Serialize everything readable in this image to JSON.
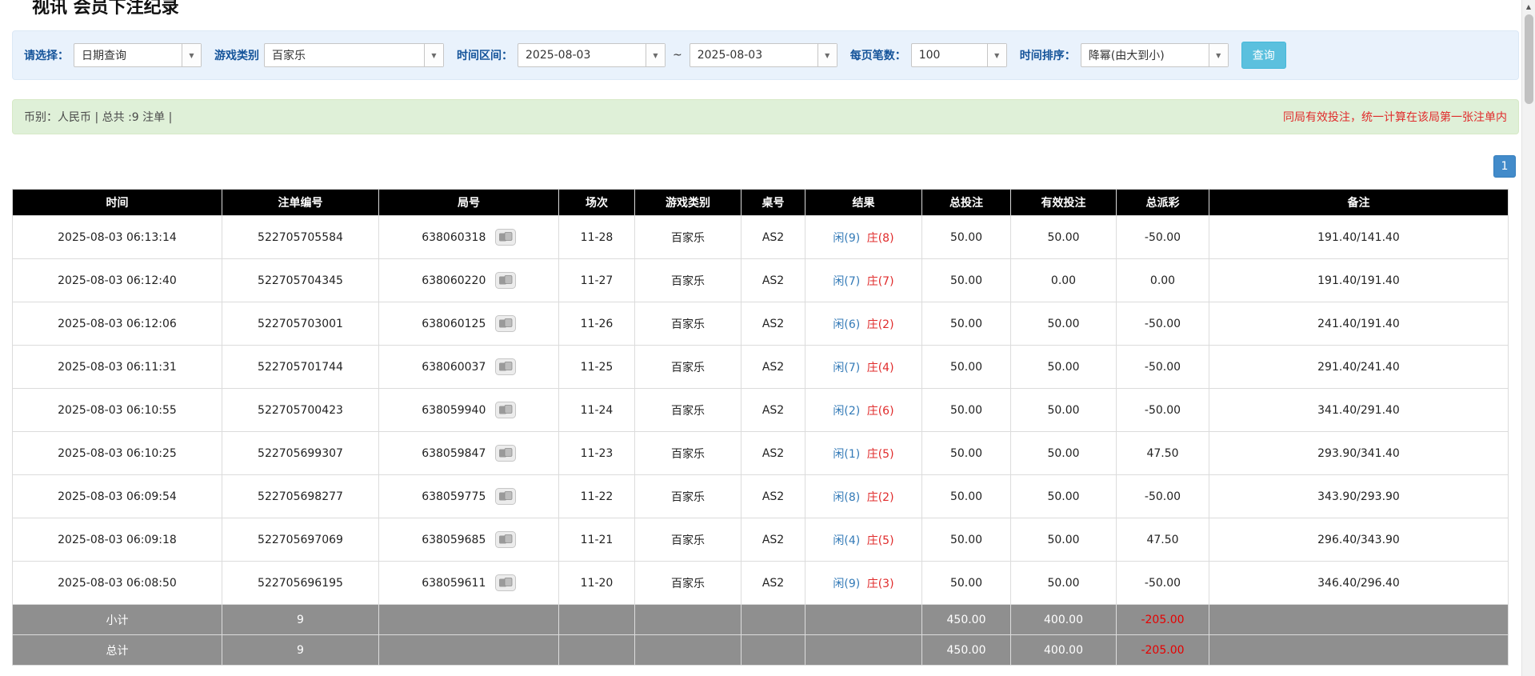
{
  "page": {
    "title": "视讯 会员下注纪录"
  },
  "icons": {
    "dropdown_caret": "▼",
    "scroll_up_arrow": "▲",
    "replay": "replay-icon"
  },
  "colors": {
    "link_blue": "#337ab7",
    "red": "#e02b2b",
    "header_bg": "#000000",
    "footer_bg": "#8f8f8f",
    "filter_bg": "#e9f2fc",
    "summary_bg": "#dff0d8",
    "query_button_bg": "#5bc0de",
    "pagination_bg": "#428bca"
  },
  "filters": {
    "select_label": "请选择：",
    "select_value": "日期查询",
    "game_type_label": "游戏类别",
    "game_type_value": "百家乐",
    "date_range_label": "时间区间：",
    "date_from": "2025-08-03",
    "date_to": "2025-08-03",
    "range_separator": "~",
    "page_size_label": "每页笔数：",
    "page_size_value": "100",
    "sort_label": "时间排序：",
    "sort_value": "降幂(由大到小)",
    "search_button": "查询"
  },
  "summary": {
    "left": "币别：人民币 | 总共 :9 注单 |",
    "right": "同局有效投注，统一计算在该局第一张注单内"
  },
  "pagination": {
    "current": "1"
  },
  "table": {
    "headers": [
      "时间",
      "注单编号",
      "局号",
      "场次",
      "游戏类别",
      "桌号",
      "结果",
      "总投注",
      "有效投注",
      "总派彩",
      "备注"
    ],
    "rows": [
      {
        "time": "2025-08-03 06:13:14",
        "bet_id": "522705705584",
        "round": "638060318",
        "session": "11-28",
        "game": "百家乐",
        "table_no": "AS2",
        "result_player": "闲(9)",
        "result_banker": "庄(8)",
        "total_bet": "50.00",
        "valid_bet": "50.00",
        "payout": "-50.00",
        "note": "191.40/141.40"
      },
      {
        "time": "2025-08-03 06:12:40",
        "bet_id": "522705704345",
        "round": "638060220",
        "session": "11-27",
        "game": "百家乐",
        "table_no": "AS2",
        "result_player": "闲(7)",
        "result_banker": "庄(7)",
        "total_bet": "50.00",
        "valid_bet": "0.00",
        "payout": "0.00",
        "note": "191.40/191.40"
      },
      {
        "time": "2025-08-03 06:12:06",
        "bet_id": "522705703001",
        "round": "638060125",
        "session": "11-26",
        "game": "百家乐",
        "table_no": "AS2",
        "result_player": "闲(6)",
        "result_banker": "庄(2)",
        "total_bet": "50.00",
        "valid_bet": "50.00",
        "payout": "-50.00",
        "note": "241.40/191.40"
      },
      {
        "time": "2025-08-03 06:11:31",
        "bet_id": "522705701744",
        "round": "638060037",
        "session": "11-25",
        "game": "百家乐",
        "table_no": "AS2",
        "result_player": "闲(7)",
        "result_banker": "庄(4)",
        "total_bet": "50.00",
        "valid_bet": "50.00",
        "payout": "-50.00",
        "note": "291.40/241.40"
      },
      {
        "time": "2025-08-03 06:10:55",
        "bet_id": "522705700423",
        "round": "638059940",
        "session": "11-24",
        "game": "百家乐",
        "table_no": "AS2",
        "result_player": "闲(2)",
        "result_banker": "庄(6)",
        "total_bet": "50.00",
        "valid_bet": "50.00",
        "payout": "-50.00",
        "note": "341.40/291.40"
      },
      {
        "time": "2025-08-03 06:10:25",
        "bet_id": "522705699307",
        "round": "638059847",
        "session": "11-23",
        "game": "百家乐",
        "table_no": "AS2",
        "result_player": "闲(1)",
        "result_banker": "庄(5)",
        "total_bet": "50.00",
        "valid_bet": "50.00",
        "payout": "47.50",
        "note": "293.90/341.40"
      },
      {
        "time": "2025-08-03 06:09:54",
        "bet_id": "522705698277",
        "round": "638059775",
        "session": "11-22",
        "game": "百家乐",
        "table_no": "AS2",
        "result_player": "闲(8)",
        "result_banker": "庄(2)",
        "total_bet": "50.00",
        "valid_bet": "50.00",
        "payout": "-50.00",
        "note": "343.90/293.90"
      },
      {
        "time": "2025-08-03 06:09:18",
        "bet_id": "522705697069",
        "round": "638059685",
        "session": "11-21",
        "game": "百家乐",
        "table_no": "AS2",
        "result_player": "闲(4)",
        "result_banker": "庄(5)",
        "total_bet": "50.00",
        "valid_bet": "50.00",
        "payout": "47.50",
        "note": "296.40/343.90"
      },
      {
        "time": "2025-08-03 06:08:50",
        "bet_id": "522705696195",
        "round": "638059611",
        "session": "11-20",
        "game": "百家乐",
        "table_no": "AS2",
        "result_player": "闲(9)",
        "result_banker": "庄(3)",
        "total_bet": "50.00",
        "valid_bet": "50.00",
        "payout": "-50.00",
        "note": "346.40/296.40"
      }
    ],
    "subtotal": {
      "label": "小计",
      "count": "9",
      "total_bet": "450.00",
      "valid_bet": "400.00",
      "payout": "-205.00"
    },
    "total": {
      "label": "总计",
      "count": "9",
      "total_bet": "450.00",
      "valid_bet": "400.00",
      "payout": "-205.00"
    }
  }
}
